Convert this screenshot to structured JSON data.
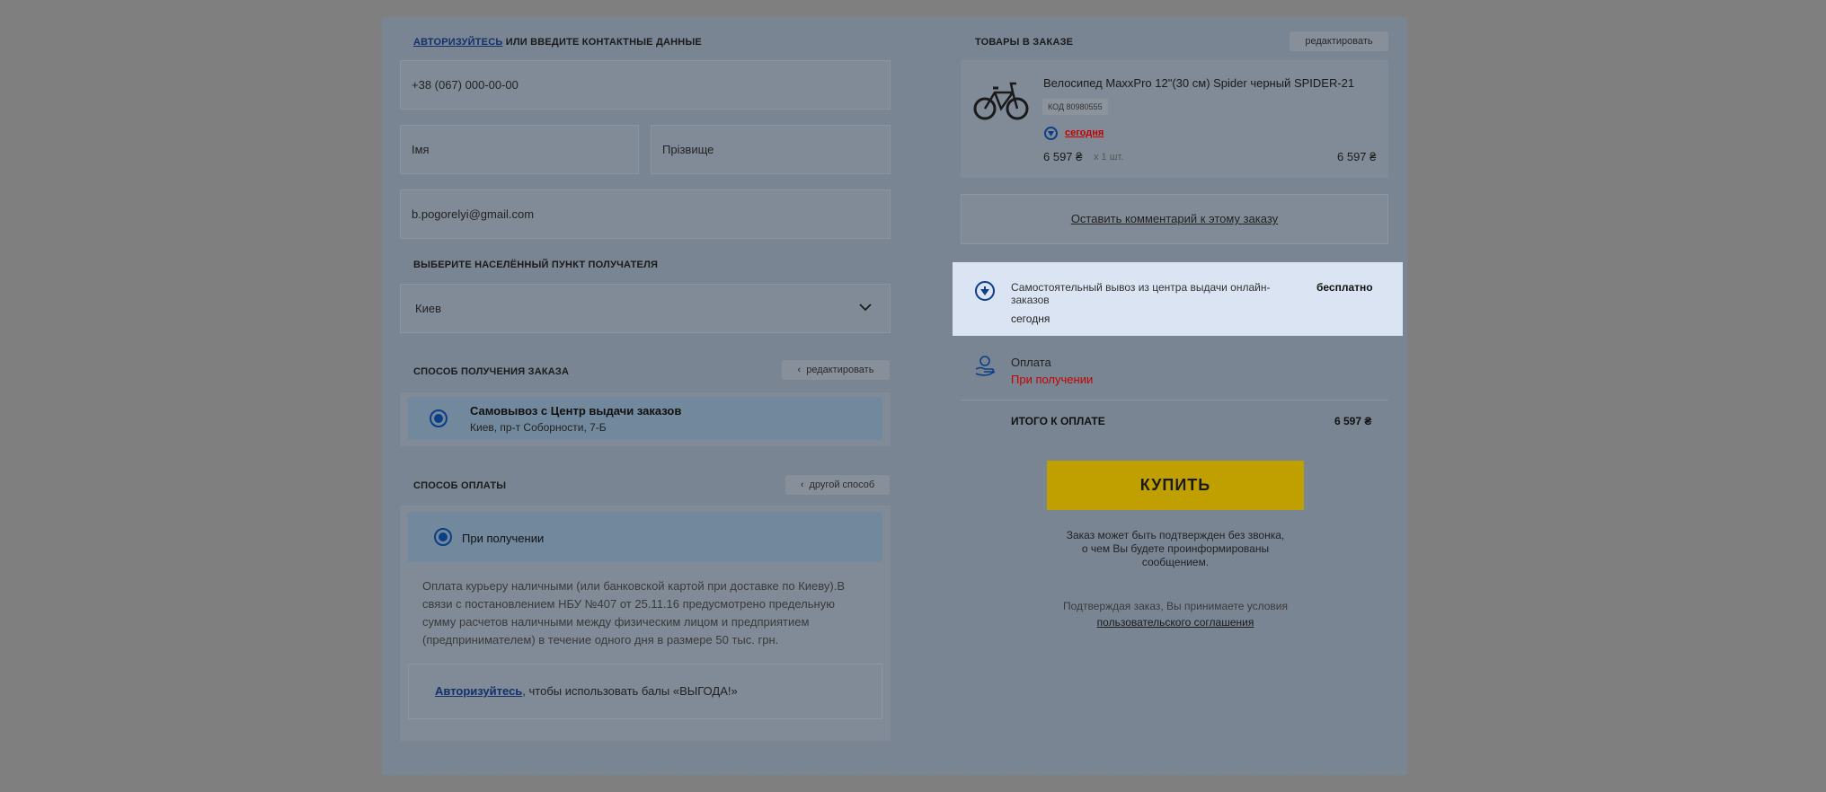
{
  "contacts": {
    "auth_link": "Авторизуйтесь",
    "title_rest": " или введите контактные данные",
    "phone": "+38 (067) 000-00-00",
    "first_name_placeholder": "Імя",
    "last_name_placeholder": "Прізвище",
    "email": "b.pogorelyi@gmail.com"
  },
  "locality": {
    "title": "Выберите населённый пункт получателя",
    "selected": "Киев"
  },
  "delivery": {
    "title": "Способ получения заказа",
    "edit_label": "редактировать",
    "option_title": "Самовывоз с Центр выдачи заказов",
    "option_address": "Киев, пр-т Соборности, 7-Б"
  },
  "payment": {
    "title": "Способ оплаты",
    "other_label": "другой способ",
    "option_label": "При получении",
    "description": "Оплата курьеру наличными (или банковской картой при доставке по Киеву).В связи с постановлением НБУ №407 от 25.11.16 предусмотрено предельную сумму расчетов наличными между физическим лицом и предприятием (предпринимателем) в течение одного дня в размере 50 тыс. грн.",
    "bonus_link": "Авторизуйтесь",
    "bonus_rest": ", чтобы использовать балы «ВЫГОДА!»"
  },
  "order": {
    "title": "Товары в заказе",
    "edit_label": "редактировать",
    "product_name": "Велосипед MaxxPro 12\"(30 см) Spider черный SPIDER-21",
    "product_code": "КОД 80980555",
    "availability": "сегодня",
    "price": "6 597 ₴",
    "quantity": "x 1 шт.",
    "line_total": "6 597 ₴",
    "comment_link": "Оставить комментарий к этому заказу"
  },
  "shipping": {
    "method": "Самостоятельный вывоз из центра выдачи онлайн-заказов",
    "when": "сегодня",
    "cost": "бесплатно"
  },
  "pay_summary": {
    "label": "Оплата",
    "value": "При получении"
  },
  "total": {
    "label": "Итого к оплате",
    "value": "6 597 ₴"
  },
  "buy_button": "Купить",
  "notice": {
    "line1": "Заказ может быть подтвержден без звонка,",
    "line2": "о чем Вы будете проинформированы",
    "line3": "сообщением.",
    "agree_text": "Подтверждая заказ, Вы принимаете условия",
    "agree_link": "пользовательского соглашения"
  },
  "colors": {
    "overlay": "#7f7f7f",
    "panel": "#7a8593",
    "highlight": "#dbe4f3",
    "brand_blue": "#0c3e86",
    "buy_yellow": "#bfa000",
    "alert_red": "#c40000"
  }
}
